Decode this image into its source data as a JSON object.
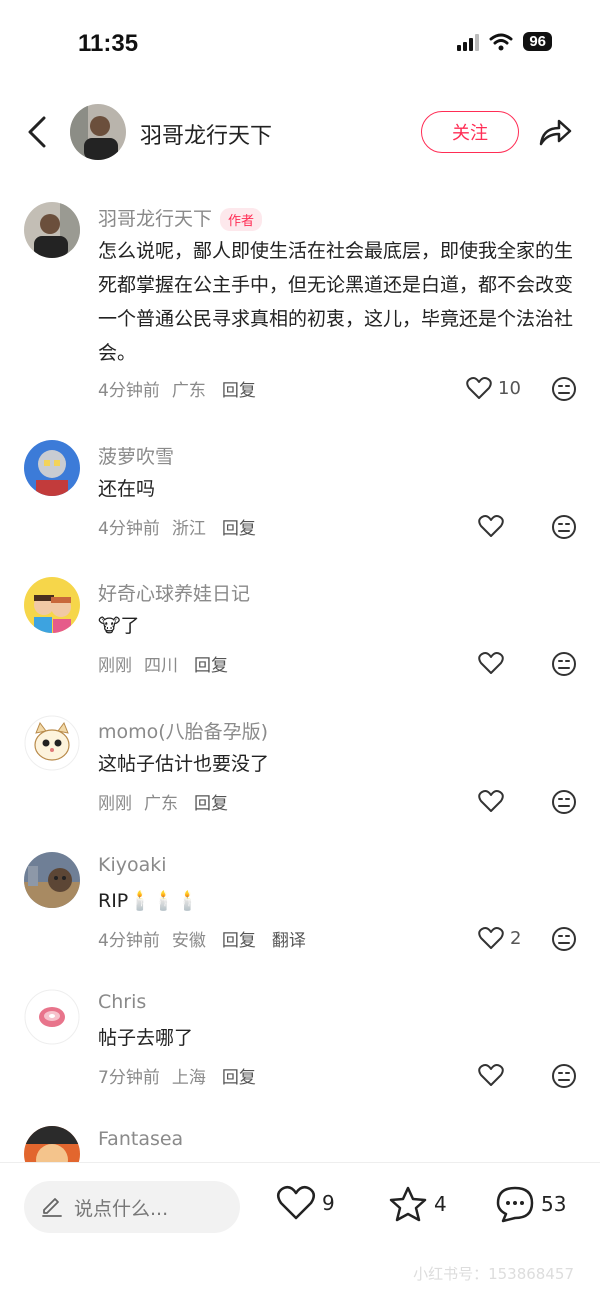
{
  "status_bar": {
    "time": "11:35",
    "battery": "96"
  },
  "nav": {
    "title": "羽哥龙行天下",
    "follow_label": "关注"
  },
  "comments": [
    {
      "name": "羽哥龙行天下",
      "badge": "作者",
      "text": "怎么说呢，鄙人即使生活在社会最底层，即使我全家的生死都掌握在公主手中，但无论黑道还是白道，都不会改变一个普通公民寻求真相的初衷，这儿，毕竟还是个法治社会。",
      "time": "4分钟前",
      "location": "广东",
      "reply": "回复",
      "likes": "10"
    },
    {
      "name": "菠萝吹雪",
      "text": "还在吗",
      "time": "4分钟前",
      "location": "浙江",
      "reply": "回复"
    },
    {
      "name": "好奇心球养娃日记",
      "text": "🐮了",
      "time": "刚刚",
      "location": "四川",
      "reply": "回复"
    },
    {
      "name": "momo(八胎备孕版)",
      "text": "这帖子估计也要没了",
      "time": "刚刚",
      "location": "广东",
      "reply": "回复"
    },
    {
      "name": "Kiyoaki",
      "text": "RIP🕯️🕯️🕯️",
      "time": "4分钟前",
      "location": "安徽",
      "reply": "回复",
      "translate": "翻译",
      "likes": "2"
    },
    {
      "name": "Chris",
      "text": "帖子去哪了",
      "time": "7分钟前",
      "location": "上海",
      "reply": "回复"
    },
    {
      "name": "Fantasea"
    }
  ],
  "bottom_bar": {
    "input_placeholder": "说点什么...",
    "likes": "9",
    "favorites": "4",
    "comments": "53",
    "watermark": "小红书号：153868457"
  },
  "colors": {
    "accent": "#ff2d55",
    "meta": "#8a8a8a"
  },
  "icons": [
    "back-icon",
    "share-icon",
    "heart-icon",
    "dislike-icon",
    "pencil-icon",
    "star-icon",
    "comment-bubble-icon",
    "wifi-icon",
    "signal-icon"
  ]
}
